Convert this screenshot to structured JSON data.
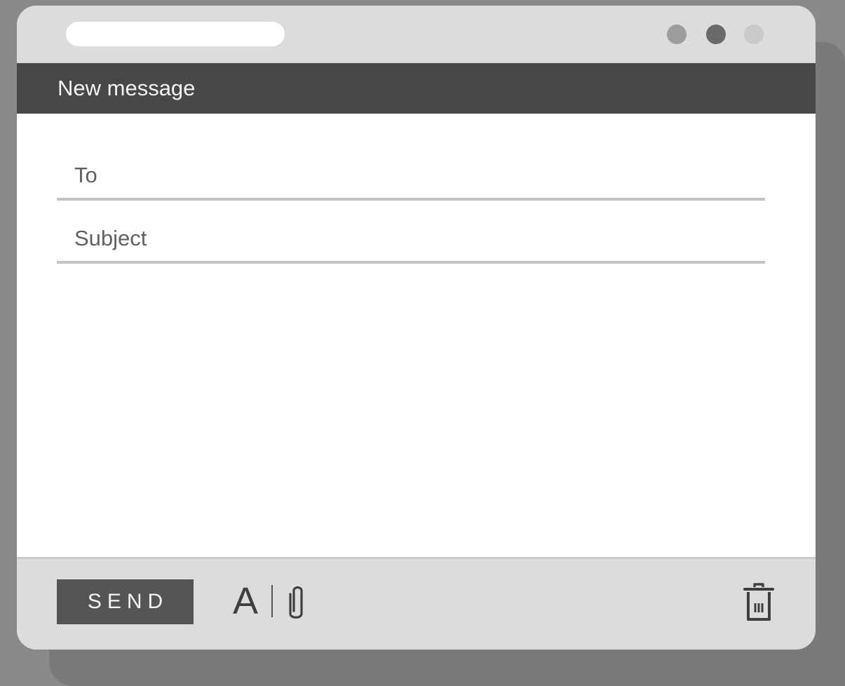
{
  "window": {
    "controls": [
      {
        "name": "window-dot-1",
        "color": "#9d9d9d"
      },
      {
        "name": "window-dot-2",
        "color": "#6a6a6a"
      },
      {
        "name": "window-dot-3",
        "color": "#c9c9c9"
      }
    ]
  },
  "header": {
    "title": "New message"
  },
  "form": {
    "to_label": "To",
    "subject_label": "Subject"
  },
  "toolbar": {
    "send_label": "SEND",
    "format_glyph": "A",
    "format_icon": "text-format-icon",
    "attach_icon": "paperclip-icon",
    "delete_icon": "trash-icon"
  },
  "colors": {
    "header_bar": "#474747",
    "chrome": "#dcdcdc",
    "send_button": "#555555",
    "background": "#8a8a8a"
  }
}
